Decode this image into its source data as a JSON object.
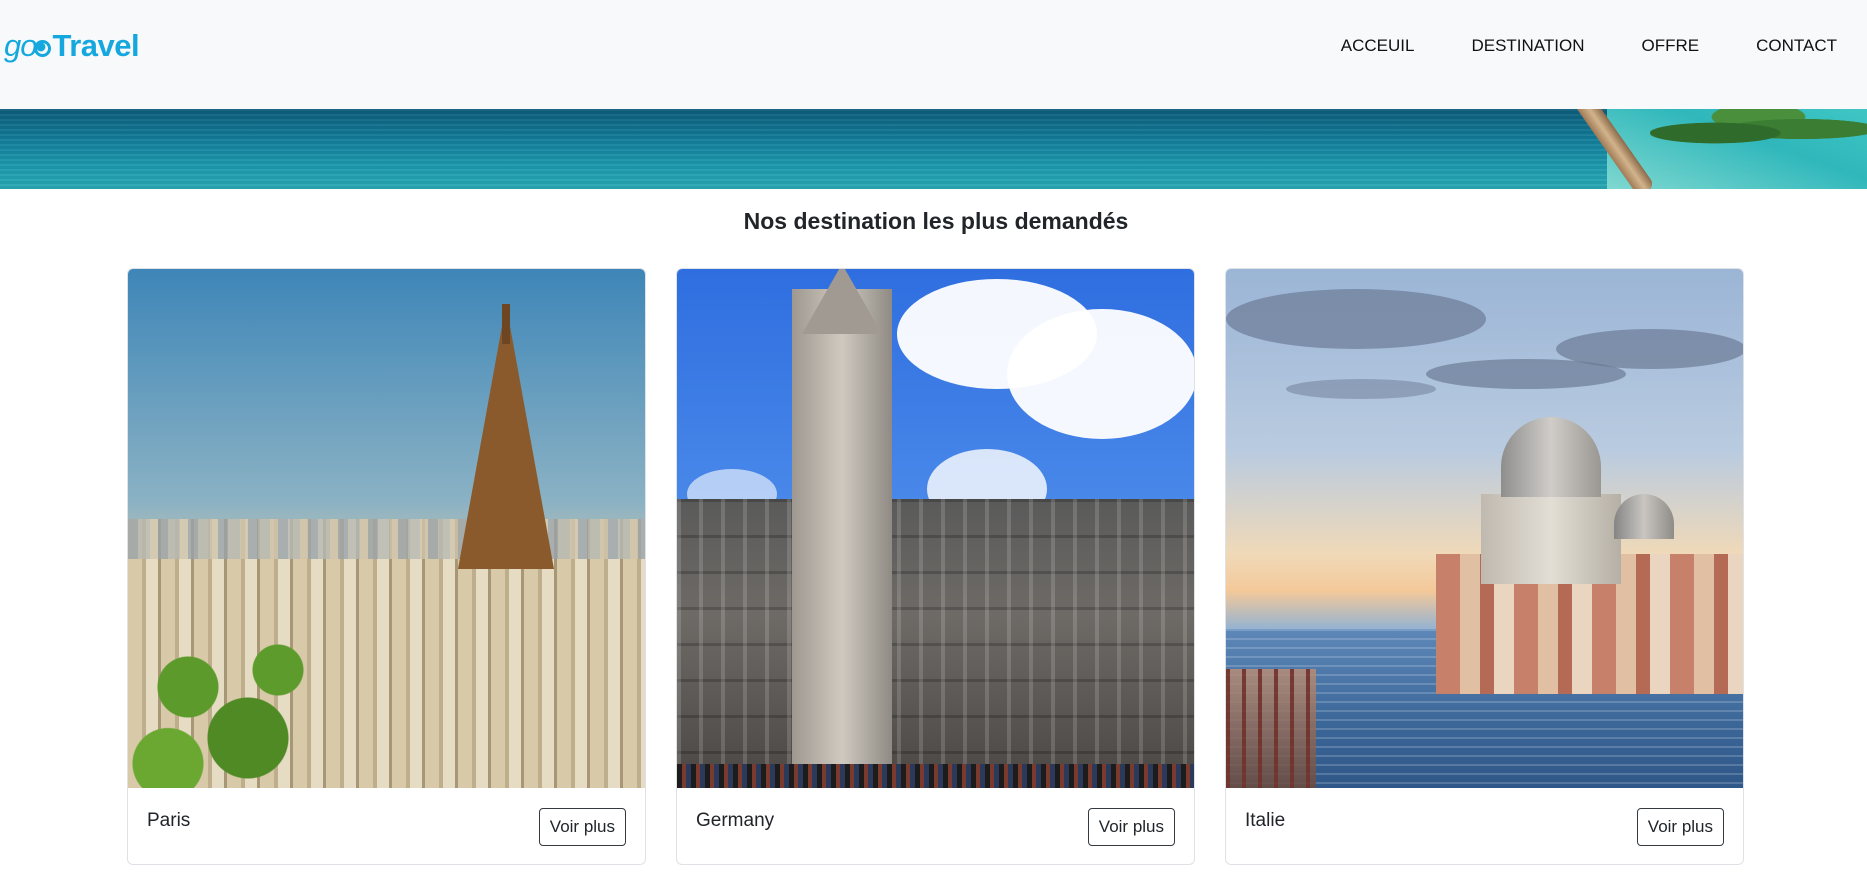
{
  "brand": {
    "prefix": "go",
    "name": "Travel",
    "color": "#15a8de"
  },
  "nav": {
    "items": [
      "ACCEUIL",
      "DESTINATION",
      "OFFRE",
      "CONTACT"
    ]
  },
  "section": {
    "title": "Nos destination les plus demandés"
  },
  "cards": [
    {
      "name": "Paris",
      "button": "Voir plus",
      "image": "eiffel-tower-photo"
    },
    {
      "name": "Germany",
      "button": "Voir plus",
      "image": "munich-town-hall-photo"
    },
    {
      "name": "Italie",
      "button": "Voir plus",
      "image": "venice-grand-canal-photo"
    }
  ]
}
